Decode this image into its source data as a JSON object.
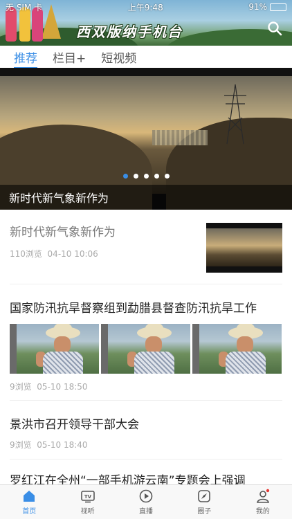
{
  "status_bar": {
    "carrier": "无 SIM 卡",
    "time": "上午9:48",
    "battery": "91%",
    "battery_level": 0.91
  },
  "header": {
    "title": "西双版纳手机台",
    "search_icon": "search-icon"
  },
  "tabs": [
    {
      "label": "推荐",
      "active": true
    },
    {
      "label": "栏目+",
      "active": false
    },
    {
      "label": "短视频",
      "active": false
    }
  ],
  "carousel": {
    "caption": "新时代新气象新作为",
    "slide_count": 5,
    "active_index": 0
  },
  "news": [
    {
      "title": "新时代新气象新作为",
      "views": "110浏览",
      "date": "04-10 10:06"
    },
    {
      "title": "国家防汛抗旱督察组到勐腊县督查防汛抗旱工作",
      "views": "9浏览",
      "date": "05-10 18:50"
    },
    {
      "title": "景洪市召开领导干部大会",
      "views": "9浏览",
      "date": "05-10 18:40"
    },
    {
      "title": "罗红江在全州“一部手机游云南”专题会上强调"
    }
  ],
  "bottom_nav": [
    {
      "label": "首页",
      "icon": "home-icon",
      "active": true
    },
    {
      "label": "视听",
      "icon": "tv-icon",
      "active": false
    },
    {
      "label": "直播",
      "icon": "play-icon",
      "active": false
    },
    {
      "label": "圈子",
      "icon": "compass-icon",
      "active": false
    },
    {
      "label": "我的",
      "icon": "profile-icon",
      "active": false
    }
  ],
  "colors": {
    "accent": "#3a8ee6"
  }
}
